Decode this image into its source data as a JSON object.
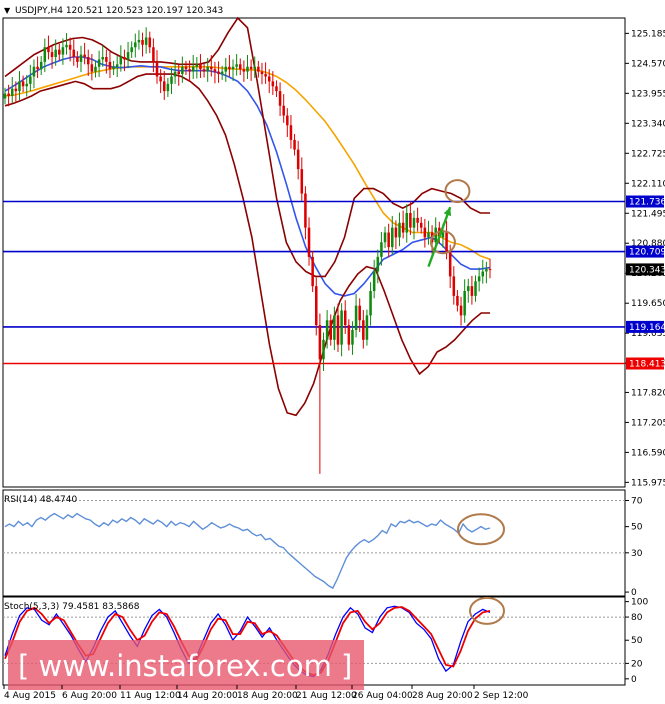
{
  "chart_data": [
    {
      "type": "candlestick",
      "title": "USDJPY,H4 120.521 120.523 120.197 120.343",
      "ylim": [
        115.88,
        125.5
      ],
      "y_ticks": [
        "125.185",
        "124.570",
        "123.955",
        "123.340",
        "122.725",
        "122.110",
        "121.495",
        "120.880",
        "120.265",
        "119.650",
        "119.035",
        "118.420",
        "117.820",
        "117.205",
        "116.590",
        "115.975"
      ],
      "y_tick_values": [
        125.185,
        124.57,
        123.955,
        123.34,
        122.725,
        122.11,
        121.495,
        120.88,
        120.265,
        119.65,
        119.035,
        118.42,
        117.82,
        117.205,
        116.59,
        115.975
      ],
      "levels": [
        {
          "value": 121.736,
          "label": "121.736",
          "color": "#0000cc"
        },
        {
          "value": 120.709,
          "label": "120.709",
          "color": "#0000cc"
        },
        {
          "value": 119.164,
          "label": "119.164",
          "color": "#0000cc"
        },
        {
          "value": 118.413,
          "label": "118.413",
          "color": "#ee0000"
        }
      ],
      "current_price": {
        "value": 120.343,
        "label": "120.343"
      },
      "x_labels": [
        "4 Aug 2015",
        "6 Aug 20:00",
        "11 Aug 12:00",
        "14 Aug 20:00",
        "18 Aug 20:00",
        "21 Aug 12:00",
        "26 Aug 04:00",
        "28 Aug 20:00",
        "2 Sep 12:00"
      ],
      "close": [
        123.95,
        123.9,
        124.05,
        124.0,
        124.2,
        124.1,
        124.15,
        124.3,
        124.5,
        124.45,
        124.6,
        124.9,
        124.8,
        124.7,
        124.85,
        124.75,
        124.9,
        124.95,
        124.85,
        124.7,
        124.6,
        124.75,
        124.7,
        124.55,
        124.4,
        124.5,
        124.65,
        124.7,
        124.6,
        124.45,
        124.5,
        124.55,
        124.7,
        124.65,
        124.8,
        124.9,
        125.0,
        125.05,
        124.95,
        125.1,
        124.9,
        124.6,
        124.3,
        124.2,
        124.0,
        124.15,
        124.3,
        124.4,
        124.35,
        124.5,
        124.45,
        124.4,
        124.5,
        124.55,
        124.45,
        124.4,
        124.5,
        124.45,
        124.4,
        124.35,
        124.4,
        124.5,
        124.45,
        124.5,
        124.55,
        124.45,
        124.4,
        124.5,
        124.45,
        124.5,
        124.4,
        124.35,
        124.3,
        124.2,
        124.1,
        124.0,
        123.7,
        123.5,
        123.3,
        123.0,
        122.8,
        122.4,
        121.9,
        121.2,
        120.6,
        120.0,
        119.2,
        118.5,
        118.9,
        119.3,
        118.9,
        119.4,
        118.8,
        119.5,
        119.2,
        118.8,
        119.1,
        119.6,
        119.3,
        118.9,
        119.4,
        119.9,
        120.3,
        120.6,
        120.9,
        121.1,
        120.8,
        121.2,
        121.0,
        121.3,
        121.1,
        121.5,
        121.2,
        121.4,
        121.3,
        121.2,
        121.0,
        121.1,
        120.9,
        121.2,
        121.0,
        121.1,
        120.7,
        120.2,
        119.8,
        119.6,
        119.4,
        119.9,
        120.0,
        119.8,
        120.1,
        120.2,
        120.3,
        120.35,
        120.343
      ],
      "high_spikes": [
        {
          "index": 37,
          "value": 125.25
        },
        {
          "index": 110,
          "value": 121.55
        }
      ],
      "low_spikes": [
        {
          "index": 87,
          "value": 116.15
        }
      ],
      "series": [
        {
          "name": "",
          "type": "line",
          "color": "#f5a400",
          "values": [
            123.9,
            123.92,
            123.97,
            124.02,
            124.08,
            124.14,
            124.2,
            124.26,
            124.32,
            124.38,
            124.42,
            124.46,
            124.48,
            124.5,
            124.5,
            124.5,
            124.5,
            124.5,
            124.5,
            124.5,
            124.5,
            124.5,
            124.48,
            124.46,
            124.45,
            124.44,
            124.43,
            124.38,
            124.3,
            124.18,
            124.02,
            123.82,
            123.6,
            123.38,
            123.1,
            122.8,
            122.5,
            122.15,
            121.82,
            121.5,
            121.3,
            121.2,
            121.1,
            121.1,
            121.1,
            121.0,
            120.9,
            120.85,
            120.75,
            120.62,
            120.55
          ]
        },
        {
          "name": "",
          "type": "line",
          "color": "#3355ee",
          "values": [
            124.0,
            124.12,
            124.25,
            124.38,
            124.5,
            124.58,
            124.65,
            124.7,
            124.7,
            124.65,
            124.55,
            124.5,
            124.48,
            124.5,
            124.52,
            124.5,
            124.5,
            124.45,
            124.42,
            124.42,
            124.42,
            124.42,
            124.38,
            124.3,
            124.2,
            124.0,
            123.7,
            123.3,
            122.75,
            122.1,
            121.4,
            120.8,
            120.4,
            120.05,
            119.85,
            119.8,
            119.85,
            120.05,
            120.3,
            120.55,
            120.65,
            120.75,
            120.9,
            120.95,
            121.0,
            120.85,
            120.65,
            120.45,
            120.35,
            120.35,
            120.38
          ]
        },
        {
          "name": "",
          "type": "line",
          "color": "#8b0000",
          "values": [
            124.3,
            124.45,
            124.6,
            124.75,
            124.85,
            124.95,
            125.02,
            125.08,
            125.1,
            125.05,
            124.95,
            124.8,
            124.7,
            124.62,
            124.6,
            124.6,
            124.6,
            124.58,
            124.55,
            124.55,
            124.55,
            124.6,
            124.85,
            125.2,
            125.5,
            125.3,
            124.2,
            123.0,
            121.8,
            120.9,
            120.5,
            120.3,
            120.2,
            120.2,
            120.5,
            121.0,
            121.8,
            122.0,
            122.0,
            121.9,
            121.7,
            121.6,
            121.7,
            121.9,
            122.0,
            121.95,
            121.9,
            121.8,
            121.6,
            121.5,
            121.5
          ]
        },
        {
          "name": "",
          "type": "line",
          "color": "#8b0000",
          "values": [
            123.7,
            123.75,
            123.82,
            123.9,
            124.0,
            124.05,
            124.1,
            124.15,
            124.2,
            124.15,
            124.05,
            124.05,
            124.05,
            124.1,
            124.2,
            124.3,
            124.35,
            124.35,
            124.35,
            124.35,
            124.3,
            124.2,
            124.05,
            123.8,
            123.5,
            123.1,
            122.5,
            121.8,
            121.0,
            119.9,
            118.8,
            117.9,
            117.4,
            117.35,
            117.6,
            118.0,
            118.6,
            119.2,
            119.7,
            120.0,
            120.25,
            120.4,
            120.35,
            119.9,
            119.4,
            118.9,
            118.5,
            118.2,
            118.35,
            118.65,
            118.75,
            118.9,
            119.1,
            119.3,
            119.45,
            119.45
          ]
        },
        {
          "name": "RSI(14) 48.4740",
          "type": "line",
          "color": "#5e8fd8",
          "ylim": [
            -3,
            78
          ],
          "y_ticks": [
            "70",
            "50",
            "30",
            "0"
          ],
          "y_tick_values": [
            70,
            50,
            30,
            0
          ],
          "levels": [
            70,
            30
          ],
          "values": [
            50,
            52,
            50,
            54,
            51,
            53,
            50,
            55,
            57,
            55,
            58,
            60,
            58,
            56,
            59,
            57,
            60,
            58,
            56,
            55,
            52,
            50,
            53,
            51,
            55,
            53,
            56,
            54,
            57,
            55,
            52,
            56,
            54,
            52,
            55,
            53,
            50,
            54,
            51,
            53,
            52,
            50,
            54,
            51,
            48,
            50,
            53,
            51,
            49,
            50,
            52,
            50,
            49,
            47,
            48,
            45,
            43,
            44,
            40,
            41,
            38,
            35,
            34,
            30,
            27,
            24,
            21,
            18,
            15,
            12,
            10,
            8,
            5,
            3,
            10,
            18,
            26,
            31,
            35,
            38,
            40,
            38,
            40,
            43,
            47,
            45,
            52,
            50,
            54,
            53,
            55,
            53,
            54,
            52,
            50,
            52,
            51,
            55,
            52,
            50,
            48,
            45,
            52,
            48,
            46,
            48,
            50,
            48,
            49
          ]
        },
        {
          "name": "Stoch(5,3,3) 79.4581 83.5868",
          "type": "line",
          "color": "#0000ff",
          "ylim": [
            -8,
            106
          ],
          "y_ticks": [
            "100",
            "80",
            "50",
            "20",
            "0"
          ],
          "y_tick_values": [
            100,
            80,
            50,
            20,
            0
          ],
          "levels": [
            80,
            20
          ],
          "values": [
            30,
            58,
            82,
            92,
            90,
            76,
            70,
            84,
            70,
            56,
            38,
            22,
            40,
            62,
            80,
            88,
            72,
            56,
            42,
            64,
            82,
            90,
            80,
            60,
            38,
            20,
            28,
            50,
            72,
            84,
            70,
            50,
            62,
            80,
            68,
            54,
            66,
            50,
            36,
            22,
            12,
            5,
            3,
            12,
            32,
            58,
            80,
            92,
            84,
            66,
            60,
            80,
            92,
            94,
            92,
            86,
            72,
            64,
            52,
            26,
            10,
            18,
            48,
            74,
            84,
            90,
            86
          ]
        },
        {
          "name": "",
          "type": "line",
          "color": "#ee0000",
          "values": [
            26,
            48,
            74,
            88,
            92,
            84,
            72,
            80,
            76,
            60,
            44,
            30,
            32,
            52,
            72,
            84,
            80,
            64,
            50,
            56,
            74,
            86,
            84,
            68,
            48,
            30,
            24,
            42,
            64,
            78,
            76,
            58,
            58,
            74,
            72,
            58,
            62,
            56,
            42,
            28,
            16,
            8,
            5,
            8,
            24,
            48,
            72,
            86,
            88,
            74,
            64,
            72,
            86,
            92,
            93,
            88,
            78,
            68,
            58,
            38,
            18,
            16,
            36,
            62,
            78,
            86,
            88
          ]
        }
      ],
      "annotations": [
        {
          "type": "circle",
          "x_index": 121,
          "y": 120.9
        },
        {
          "type": "circle",
          "x_index": 125,
          "y": 121.95
        },
        {
          "type": "arrow",
          "x_index_from": 117,
          "y_from": 120.4,
          "x_index_to": 123,
          "y_to": 121.62,
          "color": "#22aa22"
        }
      ]
    }
  ],
  "watermark": "[ www.instaforex.com ]",
  "colors": {
    "bull_candle": "#0f8a0f",
    "bear_candle": "#dd0000",
    "annotation_circle": "#b07a4a",
    "badge_fill": "#000000",
    "watermark_bg": "#e8556a"
  }
}
